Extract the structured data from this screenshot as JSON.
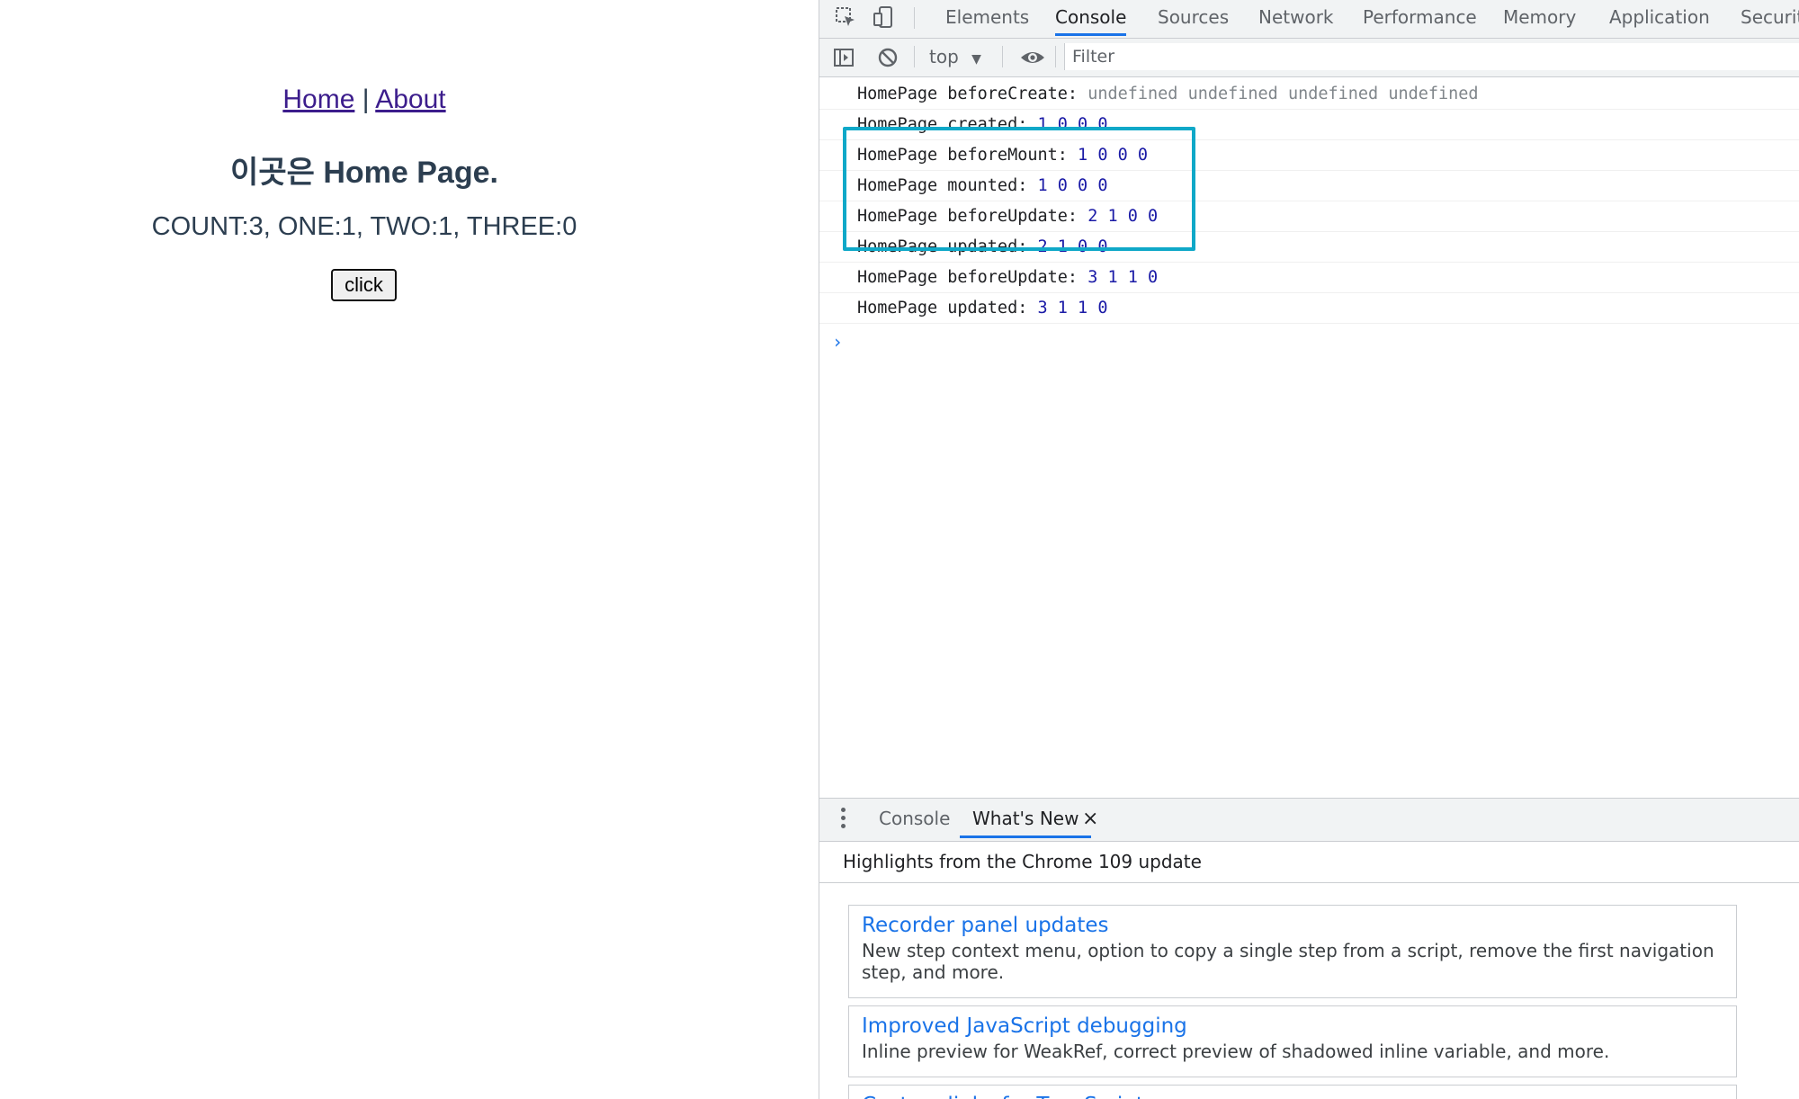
{
  "app": {
    "nav": {
      "home": "Home",
      "separator": "|",
      "about": "About"
    },
    "title": "이곳은 Home Page.",
    "counter": "COUNT:3, ONE:1, TWO:1, THREE:0",
    "button_label": "click"
  },
  "devtools": {
    "tabs": [
      "Elements",
      "Console",
      "Sources",
      "Network",
      "Performance",
      "Memory",
      "Application",
      "Security"
    ],
    "active_tab": "Console",
    "toolbar": {
      "context": "top",
      "filter_placeholder": "Filter"
    },
    "logs": [
      {
        "text": "HomePage beforeCreate:",
        "values": "undefined undefined undefined undefined",
        "kind": "undef"
      },
      {
        "text": "HomePage created:",
        "values": "1 0 0 0",
        "kind": "num"
      },
      {
        "text": "HomePage beforeMount:",
        "values": "1 0 0 0",
        "kind": "num"
      },
      {
        "text": "HomePage mounted:",
        "values": "1 0 0 0",
        "kind": "num"
      },
      {
        "text": "HomePage beforeUpdate:",
        "values": "2 1 0 0",
        "kind": "num"
      },
      {
        "text": "HomePage updated:",
        "values": "2 1 0 0",
        "kind": "num"
      },
      {
        "text": "HomePage beforeUpdate:",
        "values": "3 1 1 0",
        "kind": "num"
      },
      {
        "text": "HomePage updated:",
        "values": "3 1 1 0",
        "kind": "num"
      }
    ],
    "prompt": "›",
    "drawer": {
      "tabs": [
        "Console",
        "What's New"
      ],
      "active_tab": "What's New",
      "close": "×",
      "header": "Highlights from the Chrome 109 update",
      "highlights": [
        {
          "title": "Recorder panel updates",
          "desc": "New step context menu, option to copy a single step from a script, remove the first navigation step, and more."
        },
        {
          "title": "Improved JavaScript debugging",
          "desc": "Inline preview for WeakRef, correct preview of shadowed inline variable, and more."
        },
        {
          "title": "Custom links for TypeScript",
          "desc": ""
        }
      ]
    },
    "accent_color": "#1a73e8",
    "highlight_box_color": "#0fa8c8"
  }
}
